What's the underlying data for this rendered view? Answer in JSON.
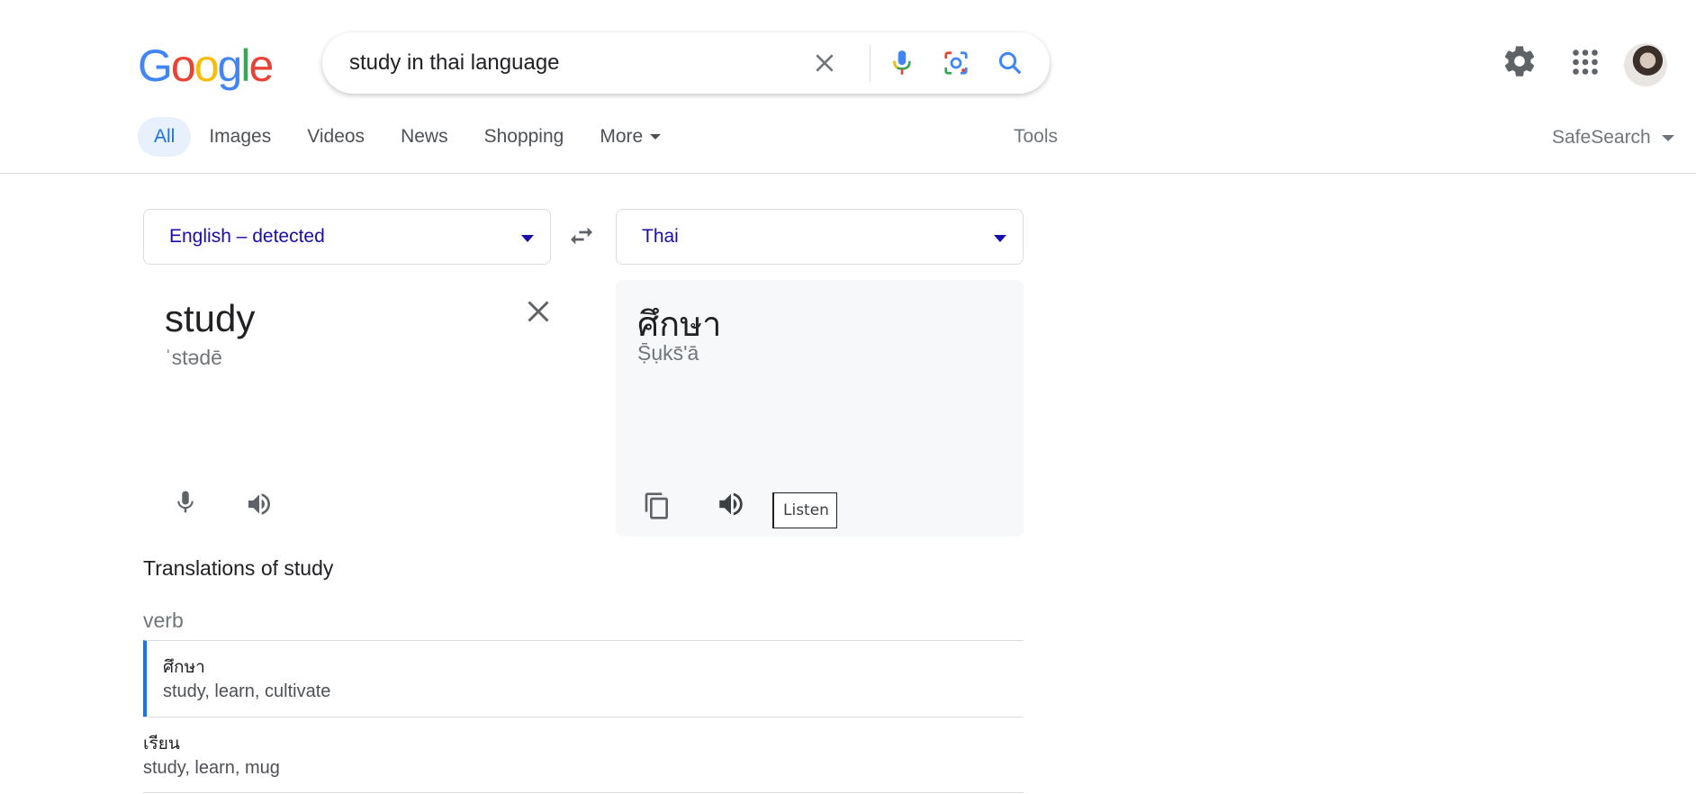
{
  "logo": {
    "text": "Google",
    "letters": [
      {
        "ch": "G",
        "color": "#4285F4"
      },
      {
        "ch": "o",
        "color": "#EA4335"
      },
      {
        "ch": "o",
        "color": "#FBBC05"
      },
      {
        "ch": "g",
        "color": "#4285F4"
      },
      {
        "ch": "l",
        "color": "#34A853"
      },
      {
        "ch": "e",
        "color": "#EA4335"
      }
    ]
  },
  "search": {
    "query": "study in thai language",
    "icons": [
      "close-icon",
      "microphone-icon",
      "lens-icon",
      "search-icon"
    ]
  },
  "header_icons": [
    "settings-icon",
    "apps-grid-icon",
    "avatar"
  ],
  "tabs": [
    {
      "label": "All",
      "active": true
    },
    {
      "label": "Images"
    },
    {
      "label": "Videos"
    },
    {
      "label": "News"
    },
    {
      "label": "Shopping"
    },
    {
      "label": "More",
      "dropdown": true
    }
  ],
  "tools_label": "Tools",
  "safesearch_label": "SafeSearch",
  "translator": {
    "source_lang": "English – detected",
    "target_lang": "Thai",
    "source_text": "study",
    "source_phonetic": "ˈstədē",
    "target_text": "ศึกษา",
    "target_phonetic": "Ṣ̄ụks̄'ā",
    "tooltip": "Listen"
  },
  "translations": {
    "title": "Translations of study",
    "pos": "verb",
    "rows": [
      {
        "thai": "ศึกษา",
        "synonyms": "study, learn, cultivate",
        "selected": true
      },
      {
        "thai": "เรียน",
        "synonyms": "study, learn, mug",
        "selected": false
      }
    ]
  },
  "colors": {
    "accent": "#1a73e8",
    "link": "#1a0dab",
    "tab_active_bg": "#e8f0fe"
  }
}
